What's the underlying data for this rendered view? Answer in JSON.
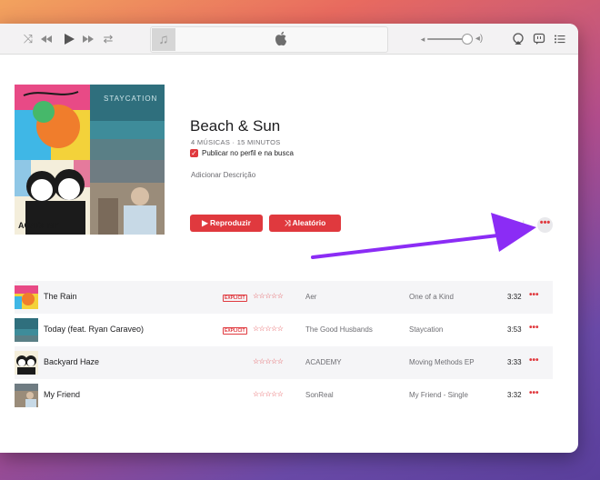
{
  "toolbar": {
    "icons": [
      "shuffle-icon",
      "previous-icon",
      "play-icon",
      "next-icon",
      "repeat-icon",
      "music-note-icon",
      "apple-logo",
      "airplay-icon",
      "lyrics-icon",
      "queue-list-icon"
    ]
  },
  "playlist": {
    "title": "Beach & Sun",
    "meta": "4 MÚSICAS · 15 MINUTOS",
    "publish_label": "Publicar no perfil e na busca",
    "description_placeholder": "Adicionar Descrição",
    "play_label": "Reproduzir",
    "shuffle_label": "Aleatório",
    "more_glyph": "•••"
  },
  "tracks": [
    {
      "title": "The Rain",
      "explicit": "EXPLICIT",
      "artist": "Aer",
      "album": "One of a Kind",
      "time": "3:32"
    },
    {
      "title": "Today (feat. Ryan Caraveo)",
      "explicit": "EXPLICIT",
      "artist": "The Good Husbands",
      "album": "Staycation",
      "time": "3:53"
    },
    {
      "title": "Backyard Haze",
      "explicit": "",
      "artist": "ACADEMY",
      "album": "Moving Methods EP",
      "time": "3:33"
    },
    {
      "title": "My Friend",
      "explicit": "",
      "artist": "SonReal",
      "album": "My Friend - Single",
      "time": "3:32"
    }
  ],
  "stars_glyph": "☆☆☆☆☆",
  "row_more_glyph": "•••",
  "colors": {
    "accent": "#e0393e",
    "annotation_arrow": "#8b2cf5"
  }
}
